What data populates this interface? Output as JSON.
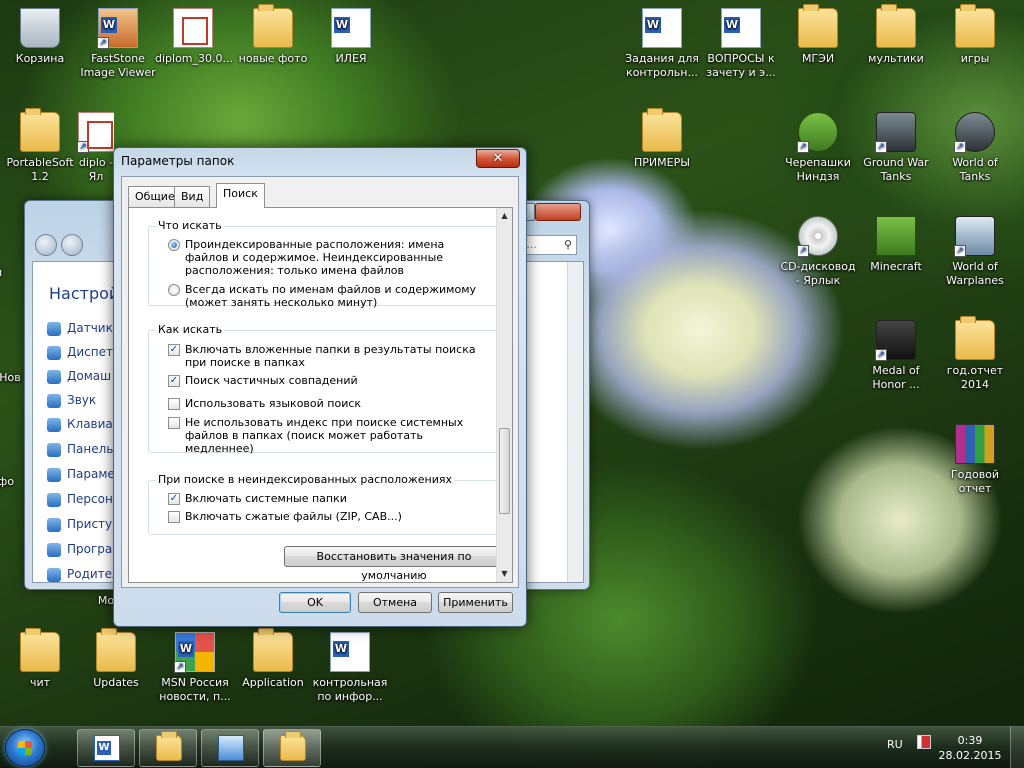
{
  "desktop_icons": [
    {
      "label": "Корзина"
    },
    {
      "label": "FastStone Image Viewer"
    },
    {
      "label": "diplom_30.0..."
    },
    {
      "label": "новые фото"
    },
    {
      "label": "ИЛЕЯ"
    },
    {
      "label": "Задания для контрольн..."
    },
    {
      "label": "ВОПРОСЫ к зачету и э..."
    },
    {
      "label": "МГЭИ"
    },
    {
      "label": "мультики"
    },
    {
      "label": "игры"
    },
    {
      "label": "PortableSoft 1.2"
    },
    {
      "label": "diplo - Ял"
    },
    {
      "label": "ПРИМЕРЫ"
    },
    {
      "label": "Черепашки Ниндзя"
    },
    {
      "label": "Ground War Tanks"
    },
    {
      "label": "World of Tanks"
    },
    {
      "label": "CD-дисковод - Ярлык"
    },
    {
      "label": "Minecraft"
    },
    {
      "label": "World of Warplanes"
    },
    {
      "label": "Medal of Honor ..."
    },
    {
      "label": "год.отчет 2014"
    },
    {
      "label": "Годовой отчет"
    },
    {
      "label": "чит"
    },
    {
      "label": "Updates"
    },
    {
      "label": "MSN Россия новости, п..."
    },
    {
      "label": "Application"
    },
    {
      "label": "контрольная по инфор..."
    }
  ],
  "background_window": {
    "title": "Настройк",
    "search_placeholder": "а...",
    "left_partial_labels": [
      "м",
      "Нов",
      "фо",
      "Mo"
    ],
    "items": [
      "Датчик",
      "Диспетч",
      "Домаш",
      "Звук",
      "Клавиат",
      "Панель",
      "Парамет",
      "Персон",
      "Присту",
      "Програ",
      "Родител"
    ]
  },
  "dialog": {
    "title": "Параметры папок",
    "close_glyph": "✕",
    "tabs": [
      "Общие",
      "Вид",
      "Поиск"
    ],
    "active_tab": "Поиск",
    "group_what": {
      "title": "Что искать",
      "options": [
        {
          "label": "Проиндексированные расположения: имена файлов и содержимое. Неиндексированные расположения: только имена файлов",
          "selected": true
        },
        {
          "label": "Всегда искать по именам файлов и содержимому (может занять несколько минут)",
          "selected": false
        }
      ]
    },
    "group_how": {
      "title": "Как искать",
      "options": [
        {
          "label": "Включать вложенные папки в результаты поиска при поиске в папках",
          "checked": true
        },
        {
          "label": "Поиск частичных совпадений",
          "checked": true
        },
        {
          "label": "Использовать языковой поиск",
          "checked": false
        },
        {
          "label": "Не использовать индекс при поиске системных файлов в папках (поиск может работать медленнее)",
          "checked": false
        }
      ]
    },
    "group_nonindexed": {
      "title": "При поиске в неиндексированных расположениях",
      "options": [
        {
          "label": "Включать системные папки",
          "checked": true
        },
        {
          "label": "Включать сжатые файлы (ZIP, CAB...)",
          "checked": false
        }
      ]
    },
    "restore_defaults_label": "Восстановить значения по умолчанию",
    "ok_label": "OK",
    "cancel_label": "Отмена",
    "apply_label": "Применить"
  },
  "taskbar": {
    "language": "RU",
    "time": "0:39",
    "date": "28.02.2015",
    "buttons": [
      "word-icon",
      "explorer-icon",
      "control-panel-icon",
      "folder-options-icon"
    ]
  }
}
